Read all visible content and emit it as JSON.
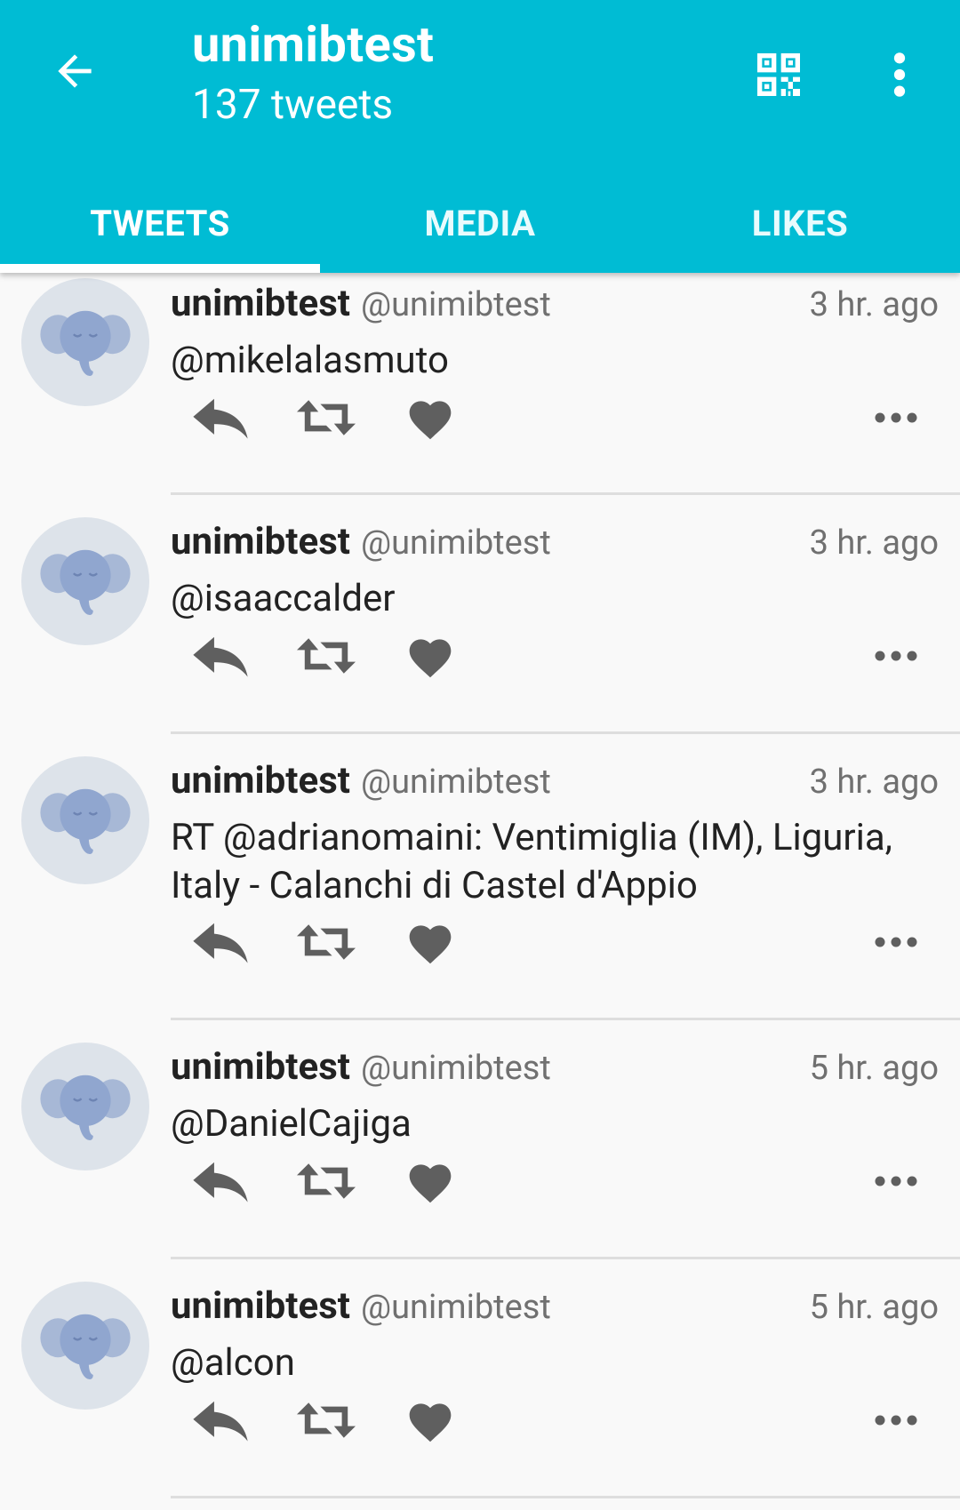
{
  "header": {
    "title": "unimibtest",
    "subtitle": "137 tweets",
    "accent_color": "#00bcd4",
    "back_icon": "arrow-left-icon",
    "qr_icon": "qr-code-icon",
    "more_icon": "more-vert-icon"
  },
  "tabs": [
    {
      "label": "TWEETS",
      "active": true
    },
    {
      "label": "MEDIA",
      "active": false
    },
    {
      "label": "LIKES",
      "active": false
    }
  ],
  "tweets": [
    {
      "name": "unimibtest",
      "handle": "@unimibtest",
      "time": "3 hr. ago",
      "text": "@mikelalasmuto"
    },
    {
      "name": "unimibtest",
      "handle": "@unimibtest",
      "time": "3 hr. ago",
      "text": "@isaaccalder"
    },
    {
      "name": "unimibtest",
      "handle": "@unimibtest",
      "time": "3 hr. ago",
      "text": "RT @adrianomaini: Ventimiglia (IM), Liguria, Italy - Calanchi di Castel d'Appio"
    },
    {
      "name": "unimibtest",
      "handle": "@unimibtest",
      "time": "5 hr. ago",
      "text": "@DanielCajiga"
    },
    {
      "name": "unimibtest",
      "handle": "@unimibtest",
      "time": "5 hr. ago",
      "text": "@alcon"
    }
  ],
  "tweet_actions": {
    "reply_icon": "reply-icon",
    "retweet_icon": "retweet-icon",
    "like_icon": "heart-icon",
    "menu_icon": "more-horiz-icon"
  }
}
